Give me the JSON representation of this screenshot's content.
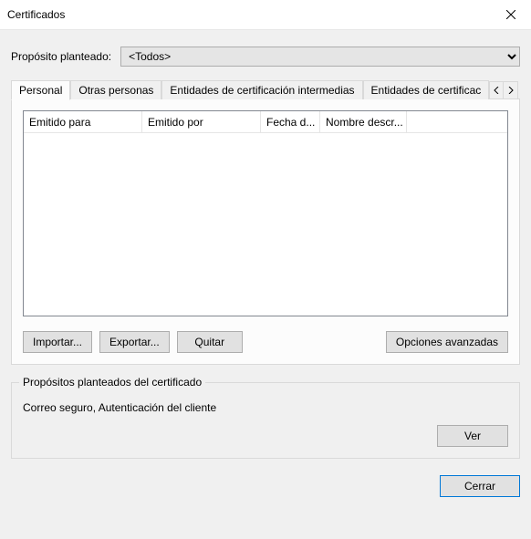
{
  "titlebar": {
    "title": "Certificados"
  },
  "purpose": {
    "label": "Propósito planteado:",
    "selected": "<Todos>",
    "options": [
      "<Todos>"
    ]
  },
  "tabs": {
    "items": [
      {
        "label": "Personal",
        "active": true
      },
      {
        "label": "Otras personas",
        "active": false
      },
      {
        "label": "Entidades de certificación intermedias",
        "active": false
      },
      {
        "label": "Entidades de certificac",
        "active": false
      }
    ]
  },
  "list": {
    "columns": [
      {
        "label": "Emitido para",
        "width": 130
      },
      {
        "label": "Emitido por",
        "width": 130
      },
      {
        "label": "Fecha d...",
        "width": 65
      },
      {
        "label": "Nombre descr...",
        "width": 95
      }
    ],
    "rows": []
  },
  "buttons": {
    "import": "Importar...",
    "export": "Exportar...",
    "remove": "Quitar",
    "advanced": "Opciones avanzadas",
    "view": "Ver",
    "close": "Cerrar"
  },
  "groupbox": {
    "legend": "Propósitos planteados del certificado",
    "value": "Correo seguro, Autenticación del cliente"
  }
}
